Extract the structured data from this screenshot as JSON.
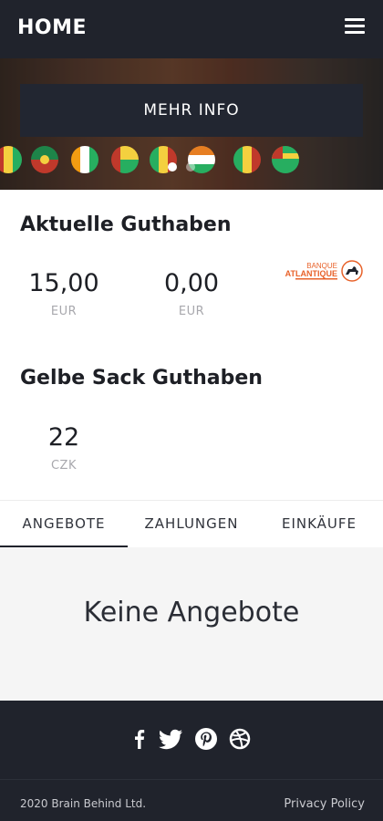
{
  "header": {
    "title": "HOME",
    "menu_icon": "hamburger-menu-icon"
  },
  "hero": {
    "button_label": "MEHR INFO",
    "slides_total": 2,
    "active_slide": 1
  },
  "balance": {
    "title": "Aktuelle Guthaben",
    "items": [
      {
        "amount": "15,00",
        "currency": "EUR"
      },
      {
        "amount": "0,00",
        "currency": "EUR"
      }
    ],
    "bank_logo": {
      "line1": "BANQUE",
      "line2": "ATLANTIQUE"
    }
  },
  "gelbe": {
    "title": "Gelbe Sack Guthaben",
    "amount": "22",
    "currency": "CZK"
  },
  "tabs": [
    {
      "label": "ANGEBOTE",
      "active": true
    },
    {
      "label": "ZAHLUNGEN",
      "active": false
    },
    {
      "label": "EINKÄUFE",
      "active": false
    }
  ],
  "empty_state": "Keine Angebote",
  "footer": {
    "social_icons": [
      "facebook-icon",
      "twitter-icon",
      "pinterest-icon",
      "dribbble-icon"
    ],
    "copyright": "2020 Brain Behind Ltd.",
    "privacy": "Privacy Policy"
  },
  "colors": {
    "dark": "#20232c",
    "bank_orange": "#e8622a"
  }
}
